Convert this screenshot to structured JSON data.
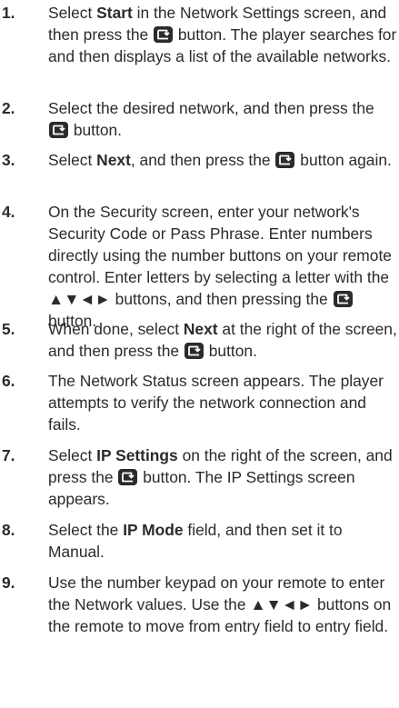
{
  "steps": [
    {
      "number": "1.",
      "parts": [
        {
          "t": "text",
          "v": "Select "
        },
        {
          "t": "bold",
          "v": "Start"
        },
        {
          "t": "text",
          "v": " in the Network Settings screen, and then press the "
        },
        {
          "t": "icon",
          "v": "enter-icon"
        },
        {
          "t": "text",
          "v": " button. The player searches for and then displays a list of the available networks."
        }
      ]
    },
    {
      "number": "2.",
      "parts": [
        {
          "t": "text",
          "v": "Select the desired network, and then press the "
        },
        {
          "t": "icon",
          "v": "enter-icon"
        },
        {
          "t": "text",
          "v": " button."
        }
      ]
    },
    {
      "number": "3.",
      "parts": [
        {
          "t": "text",
          "v": "Select "
        },
        {
          "t": "bold",
          "v": "Next"
        },
        {
          "t": "text",
          "v": ", and then press the "
        },
        {
          "t": "icon",
          "v": "enter-icon"
        },
        {
          "t": "text",
          "v": " button again."
        }
      ]
    },
    {
      "number": "4.",
      "parts": [
        {
          "t": "text",
          "v": "On the Security screen, enter your network's Security Code or Pass Phrase. Enter numbers directly using the number buttons on your remote control. Enter letters by selecting a letter with the ▲▼◄► buttons, and then pressing the "
        },
        {
          "t": "icon",
          "v": "enter-icon"
        },
        {
          "t": "text",
          "v": " button."
        }
      ]
    },
    {
      "number": "5.",
      "parts": [
        {
          "t": "text",
          "v": "When done, select "
        },
        {
          "t": "bold",
          "v": "Next"
        },
        {
          "t": "text",
          "v": " at the right of the screen, and then press the "
        },
        {
          "t": "icon",
          "v": "enter-icon"
        },
        {
          "t": "text",
          "v": " button."
        }
      ]
    },
    {
      "number": "6.",
      "parts": [
        {
          "t": "text",
          "v": "The Network Status screen appears. The player attempts to verify the network connection and fails."
        }
      ]
    },
    {
      "number": "7.",
      "parts": [
        {
          "t": "text",
          "v": "Select "
        },
        {
          "t": "bold",
          "v": "IP Settings"
        },
        {
          "t": "text",
          "v": " on the right of the screen, and press the "
        },
        {
          "t": "icon",
          "v": "enter-icon"
        },
        {
          "t": "text",
          "v": " button. The IP Settings screen appears."
        }
      ]
    },
    {
      "number": "8.",
      "parts": [
        {
          "t": "text",
          "v": "Select the "
        },
        {
          "t": "bold",
          "v": "IP Mode"
        },
        {
          "t": "text",
          "v": " field, and then set it to Manual."
        }
      ]
    },
    {
      "number": "9.",
      "parts": [
        {
          "t": "text",
          "v": "Use the number keypad on your remote to enter the Network values. Use the ▲▼◄► buttons on the remote to move from entry field to entry field."
        }
      ]
    }
  ]
}
